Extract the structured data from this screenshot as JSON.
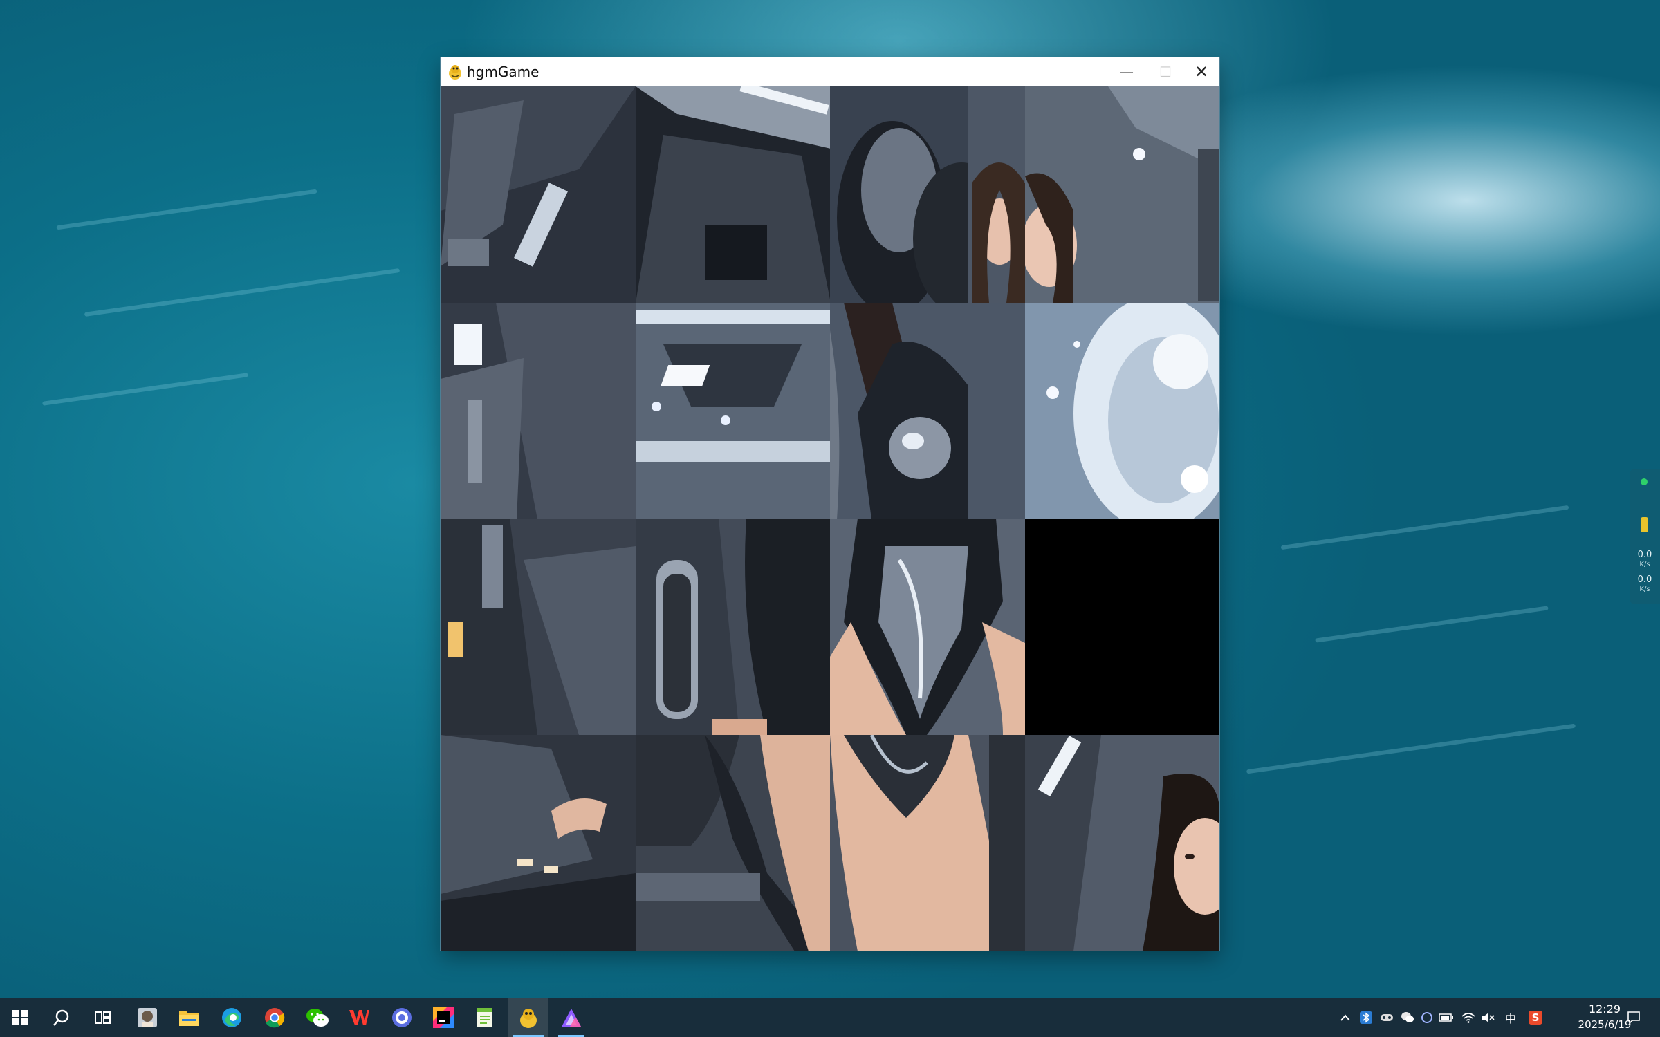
{
  "window": {
    "title": "hgmGame",
    "controls": {
      "minimize": "—",
      "maximize": "☐",
      "close": "✕"
    }
  },
  "board": {
    "grid": "4x4",
    "empty_tile": {
      "row": 3,
      "col": 4
    }
  },
  "network_widget": {
    "upload": "0.0",
    "upload_unit": "K/s",
    "download": "0.0",
    "download_unit": "K/s"
  },
  "taskbar": {
    "apps": [
      "windows-start",
      "search",
      "task-view",
      "photo-viewer",
      "file-explorer",
      "edge",
      "chrome",
      "wechat",
      "wps",
      "browser-circle",
      "jetbrains",
      "notepad",
      "pygame",
      "ai-tool"
    ],
    "tray": {
      "input_method": "中",
      "sogou": "S",
      "time": "12:29",
      "date": "2025/6/19"
    }
  }
}
